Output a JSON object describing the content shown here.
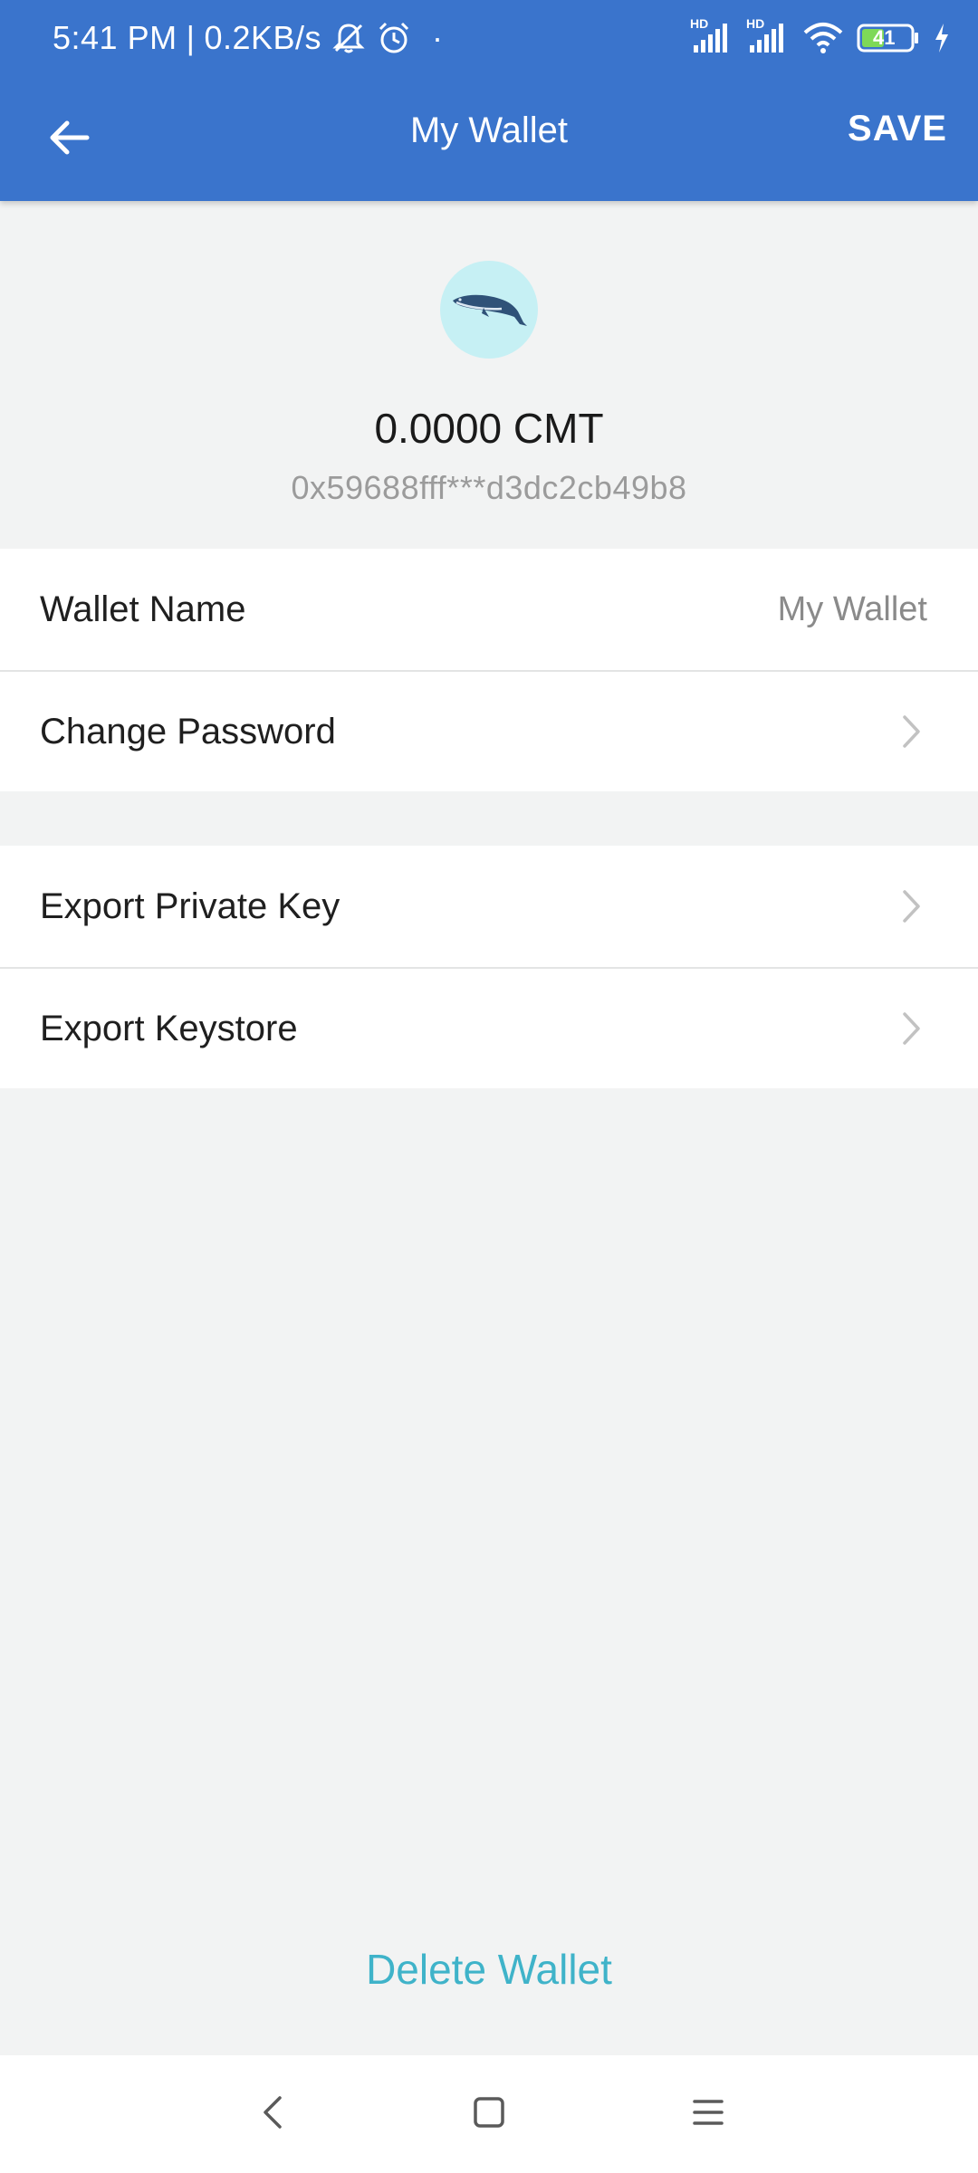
{
  "status_bar": {
    "time": "5:41 PM",
    "separator": "|",
    "speed": "0.2KB/s",
    "dot": "·",
    "battery_level": "41",
    "network_badge_1": "HD",
    "network_badge_2": "HD",
    "icons": [
      "muted-bell-icon",
      "alarm-clock-icon",
      "signal-icon",
      "signal-icon",
      "wifi-icon",
      "battery-icon",
      "charging-bolt-icon"
    ]
  },
  "app_bar": {
    "back_icon": "arrow-left-icon",
    "title": "My Wallet",
    "save_label": "SAVE"
  },
  "wallet": {
    "avatar_icon": "whale-icon",
    "balance": "0.0000 CMT",
    "address": "0x59688fff***d3dc2cb49b8"
  },
  "settings": {
    "group1": [
      {
        "label": "Wallet Name",
        "value": "My Wallet"
      },
      {
        "label": "Change Password",
        "icon": "chevron-right-icon"
      }
    ],
    "group2": [
      {
        "label": "Export Private Key",
        "icon": "chevron-right-icon"
      },
      {
        "label": "Export Keystore",
        "icon": "chevron-right-icon"
      }
    ]
  },
  "delete_label": "Delete Wallet",
  "nav_bar": {
    "icons": [
      "nav-back-icon",
      "nav-home-icon",
      "nav-menu-icon"
    ]
  },
  "colors": {
    "header": "#3a74cc",
    "background": "#f2f3f3",
    "avatar_bg": "#c6f0f4",
    "delete_text": "#3fb3c9",
    "battery_fill": "#7ed957"
  }
}
